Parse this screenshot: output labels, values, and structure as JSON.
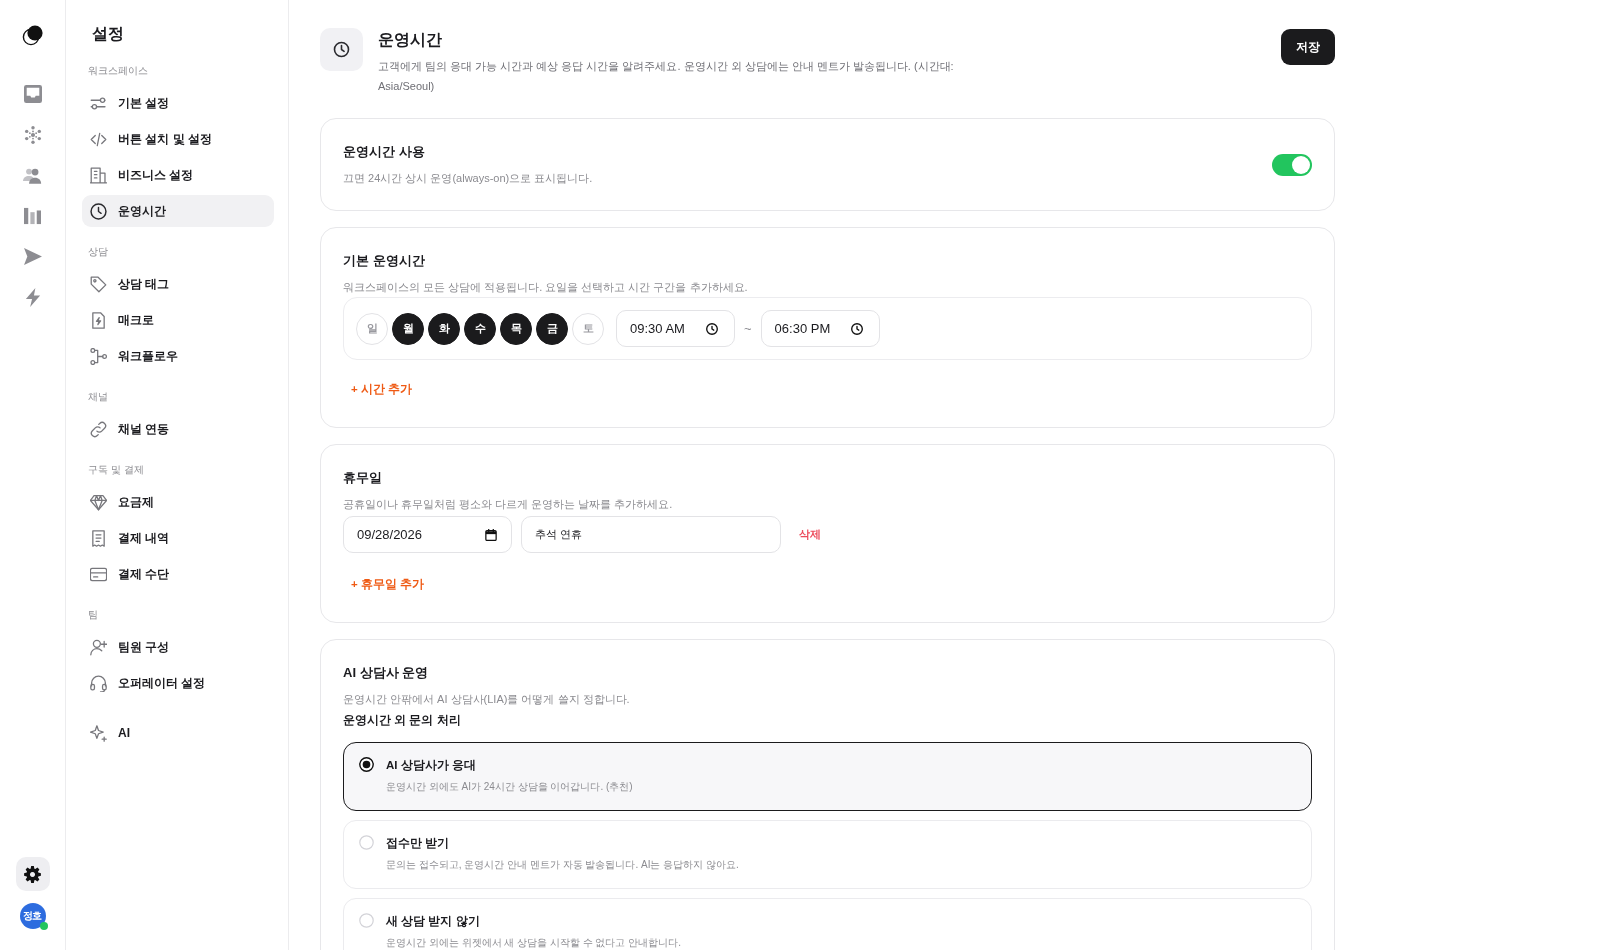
{
  "rail": {
    "settings": {
      "selected": true
    },
    "user": {
      "initials": "정호",
      "online": true
    }
  },
  "sidebar": {
    "title": "설정",
    "sections": [
      {
        "label": "워크스페이스",
        "items": [
          {
            "label": "기본 설정",
            "selected": false
          },
          {
            "label": "버튼 설치 및 설정",
            "selected": false
          },
          {
            "label": "비즈니스 설정",
            "selected": false
          },
          {
            "label": "운영시간",
            "selected": true
          }
        ]
      },
      {
        "label": "상담",
        "items": [
          {
            "label": "상담 태그",
            "selected": false
          },
          {
            "label": "매크로",
            "selected": false
          },
          {
            "label": "워크플로우",
            "selected": false
          }
        ]
      },
      {
        "label": "채널",
        "items": [
          {
            "label": "채널 연동",
            "selected": false
          }
        ]
      },
      {
        "label": "구독 및 결제",
        "items": [
          {
            "label": "요금제",
            "selected": false
          },
          {
            "label": "결제 내역",
            "selected": false
          },
          {
            "label": "결제 수단",
            "selected": false
          }
        ]
      },
      {
        "label": "팀",
        "items": [
          {
            "label": "팀원 구성",
            "selected": false
          },
          {
            "label": "오퍼레이터 설정",
            "selected": false
          }
        ]
      },
      {
        "items": [
          {
            "label": "AI",
            "selected": false
          }
        ]
      }
    ]
  },
  "header": {
    "title": "운영시간",
    "description": "고객에게 팀의 응대 가능 시간과 예상 응답 시간을 알려주세요. 운영시간 외 상담에는 안내 멘트가 발송됩니다. (시간대: Asia/Seoul)",
    "save_button": "저장"
  },
  "business_hours": {
    "title": "운영시간 사용",
    "description": "끄면 24시간 상시 운영(always-on)으로 표시됩니다.",
    "on": true
  },
  "default_hours": {
    "title": "기본 운영시간",
    "description": "워크스페이스의 모든 상담에 적용됩니다. 요일을 선택하고 시간 구간을 추가하세요.",
    "days": [
      {
        "label": "일",
        "selected": false
      },
      {
        "label": "월",
        "selected": true
      },
      {
        "label": "화",
        "selected": true
      },
      {
        "label": "수",
        "selected": true
      },
      {
        "label": "목",
        "selected": true
      },
      {
        "label": "금",
        "selected": true
      },
      {
        "label": "토",
        "selected": false
      }
    ],
    "start_time": "09:30 AM",
    "separator": "~",
    "end_time": "06:30 PM",
    "add_button": "+ 시간 추가"
  },
  "holidays": {
    "title": "휴무일",
    "description": "공휴일이나 휴무일처럼 평소와 다르게 운영하는 날짜를 추가하세요.",
    "rows": [
      {
        "date": "09/28/2026",
        "name": "추석 연휴",
        "delete_button": "삭제"
      }
    ],
    "add_button": "+ 휴무일 추가"
  },
  "ai_agent": {
    "title": "AI 상담사 운영",
    "description": "운영시간 안팎에서 AI 상담사(LIA)를 어떻게 쓸지 정합니다.",
    "subheading": "운영시간 외 문의 처리",
    "options": [
      {
        "title": "AI 상담사가 응대",
        "description": "운영시간 외에도 AI가 24시간 상담을 이어갑니다. (추천)",
        "selected": true
      },
      {
        "title": "접수만 받기",
        "description": "문의는 접수되고, 운영시간 안내 멘트가 자동 발송됩니다. AI는 응답하지 않아요.",
        "selected": false
      },
      {
        "title": "새 상담 받지 않기",
        "description": "운영시간 외에는 위젯에서 새 상담을 시작할 수 없다고 안내합니다.",
        "selected": false
      }
    ]
  }
}
